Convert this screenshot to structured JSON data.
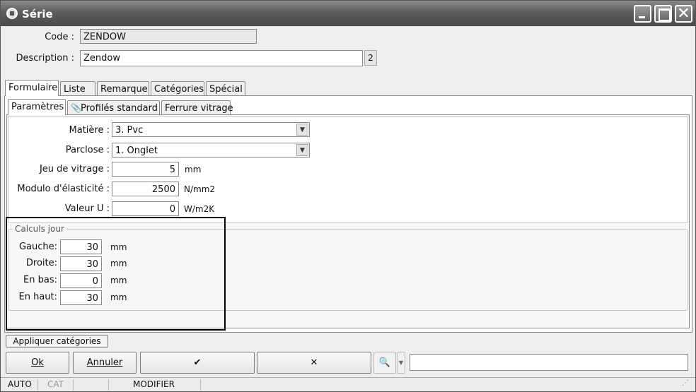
{
  "window": {
    "title": "Série"
  },
  "form": {
    "code_label": "Code :",
    "code_value": "ZENDOW",
    "description_label": "Description :",
    "description_value": "Zendow",
    "description_badge": "2"
  },
  "tabs": [
    {
      "label": "Formulaire"
    },
    {
      "label": "Liste"
    },
    {
      "label": "Remarque"
    },
    {
      "label": "Catégories"
    },
    {
      "label": "Spécial"
    }
  ],
  "subtabs": [
    {
      "label": "Paramètres"
    },
    {
      "label": "Profilés standard"
    },
    {
      "label": "Ferrure vitrage"
    }
  ],
  "params": {
    "matiere_label": "Matière :",
    "matiere_value": "3.  Pvc",
    "parclose_label": "Parclose :",
    "parclose_value": "1.  Onglet",
    "jeu_label": "Jeu de vitrage :",
    "jeu_value": "5",
    "jeu_unit": "mm",
    "modulo_label": "Modulo d'élasticité :",
    "modulo_value": "2500",
    "modulo_unit": "N/mm2",
    "valeur_label": "Valeur U :",
    "valeur_value": "0",
    "valeur_unit": "W/m2K"
  },
  "calculs": {
    "legend": "Calculs jour",
    "gauche_label": "Gauche:",
    "gauche_value": "30",
    "droite_label": "Droite:",
    "droite_value": "30",
    "enbas_label": "En bas:",
    "enbas_value": "0",
    "enhaut_label": "En haut:",
    "enhaut_value": "30",
    "unit": "mm"
  },
  "actions": {
    "apply_categories": "Appliquer catégories",
    "ok": "Ok",
    "cancel": "Annuler",
    "confirm_symbol": "✔",
    "close_symbol": "✕",
    "search_icon": "binoculars-icon"
  },
  "status": {
    "auto": "AUTO",
    "cat": "CAT",
    "mode": "MODIFIER"
  }
}
